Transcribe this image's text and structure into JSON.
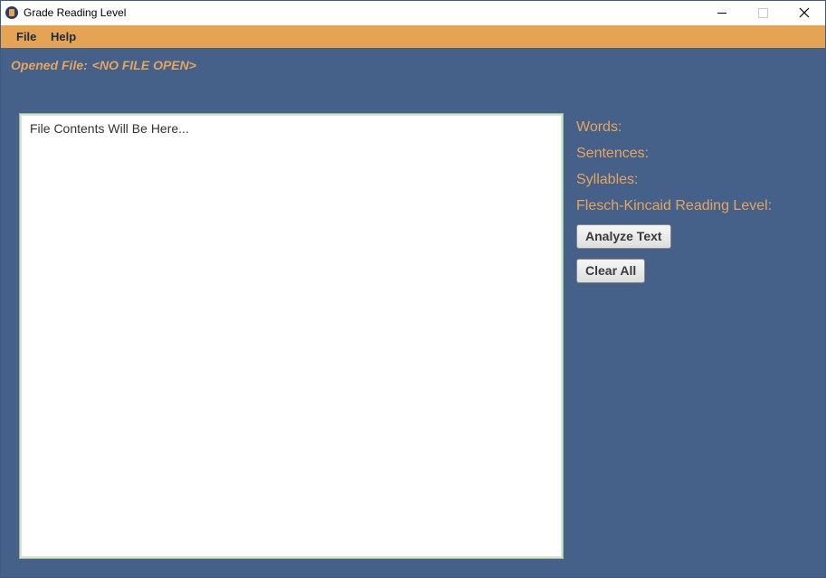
{
  "window": {
    "title": "Grade Reading Level"
  },
  "menu": {
    "file_label": "File",
    "help_label": "Help"
  },
  "status": {
    "opened_file_label": "Opened File:",
    "opened_file_value": "<NO FILE OPEN>"
  },
  "editor": {
    "content": "File Contents Will Be Here..."
  },
  "stats": {
    "words_label": "Words:",
    "sentences_label": "Sentences:",
    "syllables_label": "Syllables:",
    "flesch_label": "Flesch-Kincaid Reading Level:"
  },
  "buttons": {
    "analyze_label": "Analyze Text",
    "clear_label": "Clear All"
  },
  "colors": {
    "background": "#456189",
    "menubar": "#e5a454",
    "accent_text": "#e6a55c"
  },
  "icons": {
    "app": "app-book-icon",
    "minimize": "minimize-icon",
    "maximize": "maximize-icon",
    "close": "close-icon"
  }
}
